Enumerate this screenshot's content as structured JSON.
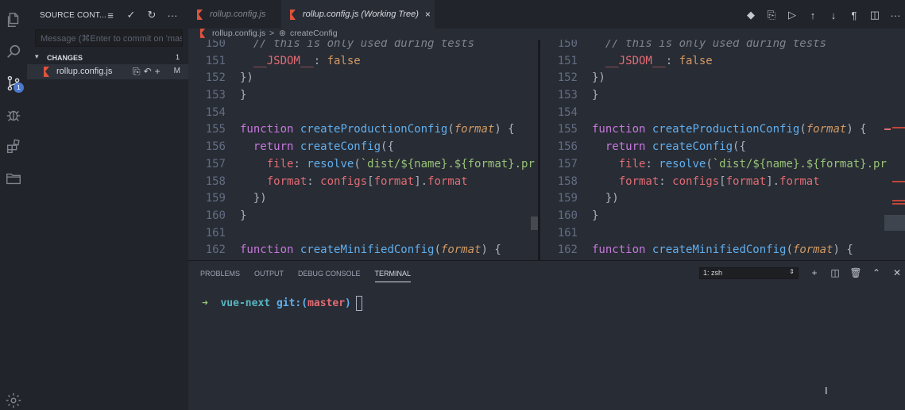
{
  "sidebar": {
    "title": "SOURCE CONT...",
    "commit_placeholder": "Message (⌘Enter to commit on 'maste",
    "changes_label": "CHANGES",
    "changes_count": "1",
    "file": {
      "name": "rollup.config.js",
      "status": "M"
    }
  },
  "activity": {
    "scm_badge": "1"
  },
  "tabs": [
    {
      "label": "rollup.config.js",
      "active": false
    },
    {
      "label": "rollup.config.js (Working Tree)",
      "active": true,
      "close": "×"
    }
  ],
  "breadcrumb": {
    "file": "rollup.config.js",
    "separator": ">",
    "symbol": "createConfig"
  },
  "panel": {
    "tabs": [
      "PROBLEMS",
      "OUTPUT",
      "DEBUG CONSOLE",
      "TERMINAL"
    ],
    "active_tab": "TERMINAL",
    "terminal_select": "1: zsh",
    "prompt": {
      "arrow": "➜",
      "dir": "vue-next",
      "git": "git:(",
      "branch": "master",
      "git_close": ")"
    }
  },
  "code_left": [
    {
      "n": "150",
      "t": "  // this is only used during tests"
    },
    {
      "n": "151",
      "t": "  __JSDOM__: false"
    },
    {
      "n": "152",
      "t": "})"
    },
    {
      "n": "153",
      "t": "}"
    },
    {
      "n": "154",
      "t": ""
    },
    {
      "n": "155",
      "t": "function createProductionConfig(format) {"
    },
    {
      "n": "156",
      "t": "  return createConfig({"
    },
    {
      "n": "157",
      "t": "    file: resolve(`dist/${name}.${format}.pr"
    },
    {
      "n": "158",
      "t": "    format: configs[format].format"
    },
    {
      "n": "159",
      "t": "  })"
    },
    {
      "n": "160",
      "t": "}"
    },
    {
      "n": "161",
      "t": ""
    },
    {
      "n": "162",
      "t": "function createMinifiedConfig(format) {"
    }
  ],
  "colors": {
    "accent": "#4d78cc",
    "background": "#282c34",
    "sidebar": "#21252b"
  }
}
